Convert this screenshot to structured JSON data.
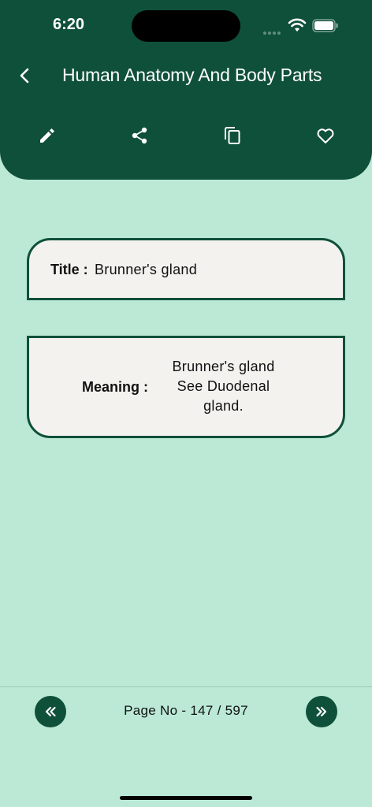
{
  "status_bar": {
    "time": "6:20"
  },
  "header": {
    "title": "Human Anatomy And Body Parts",
    "background_color": "#0f503a"
  },
  "toolbar": {
    "icons": [
      "edit-icon",
      "share-icon",
      "copy-icon",
      "favorite-icon"
    ]
  },
  "entry": {
    "title_label": "Title :",
    "title_value": "Brunner's gland",
    "meaning_label": "Meaning :",
    "meaning_value": "Brunner's gland See Duodenal gland."
  },
  "pagination": {
    "page_label": "Page No - 147 / 597",
    "prev_icon": "double-chevron-left-icon",
    "next_icon": "double-chevron-right-icon"
  },
  "colors": {
    "page_background": "#bbe9d6",
    "card_background": "#f4f2ef",
    "accent": "#0f503a"
  }
}
